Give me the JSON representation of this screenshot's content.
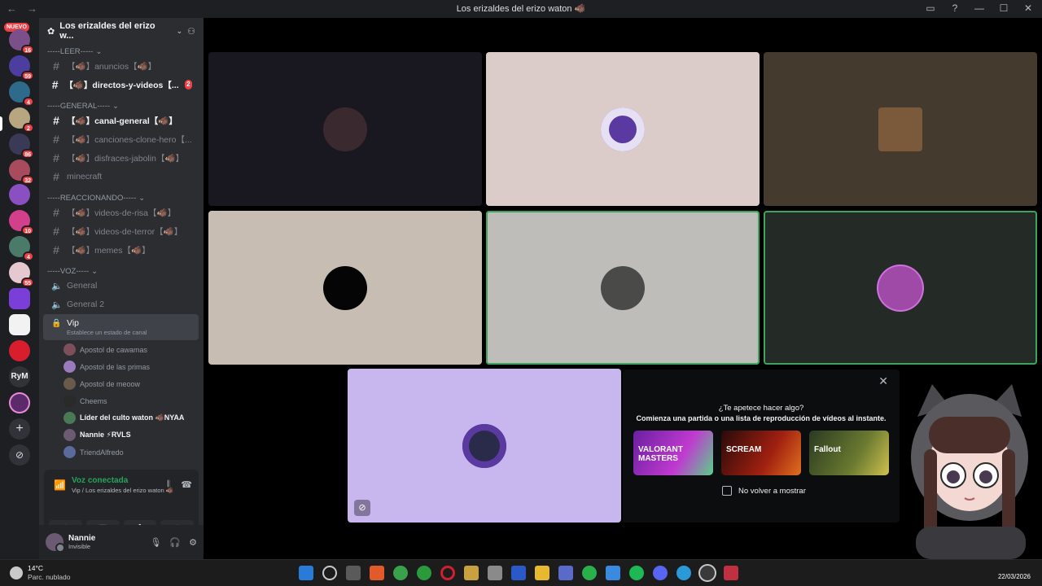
{
  "window": {
    "title": "Los erizaldes del erizo waton 🐗",
    "nav": [
      "←",
      "→"
    ],
    "controls": [
      "▭",
      "?",
      "—",
      "☐",
      "✕"
    ]
  },
  "rail": {
    "nuevo_label": "NUEVO",
    "badges": [
      "16",
      "59",
      "4",
      "2",
      "86",
      "32",
      "",
      "10",
      "4",
      "55"
    ],
    "text_server": "RyM"
  },
  "server": {
    "name": "Los erizaldes del erizo w...",
    "categories": {
      "leer": "-----LEER-----",
      "general": "-----GENERAL-----",
      "reaccionando": "-----REACCIONANDO-----",
      "voz": "-----VOZ-----"
    },
    "channels": {
      "anuncios": "【🐗】anuncios【🐗】",
      "directos": "【🐗】directos-y-videos【...",
      "directos_badge": "2",
      "canal_general": "【🐗】canal-general【🐗】",
      "canciones": "【🐗】canciones-clone-hero【...",
      "disfraces": "【🐗】disfraces-jabolin【🐗】",
      "minecraft": "minecraft",
      "risa": "【🐗】videos-de-risa【🐗】",
      "terror": "【🐗】videos-de-terror【🐗】",
      "memes": "【🐗】memes【🐗】",
      "voice_general": "General",
      "voice_general2": "General 2",
      "vip": "Vip",
      "vip_status": "Establece un estado de canal"
    },
    "members": [
      {
        "name": "Apostol de cawamas",
        "color": "#7d4e5c",
        "on": false
      },
      {
        "name": "Apostol de las primas",
        "color": "#9b7bbf",
        "on": false
      },
      {
        "name": "Apostol de meoow",
        "color": "#6a5a4a",
        "on": false
      },
      {
        "name": "Cheems",
        "color": "#2a2a2a",
        "on": false
      },
      {
        "name": "Líder del culto waton 🐗NYAA",
        "color": "#4a7a55",
        "on": true
      },
      {
        "name": "Nannie ⚡RVLS",
        "color": "#6b5a72",
        "on": true
      },
      {
        "name": "TriendAlfredo",
        "color": "#5a6a9a",
        "on": false
      }
    ]
  },
  "voice": {
    "status": "Voz conectada",
    "location": "Vip / Los erizaldes del erizo waton 🐗"
  },
  "user": {
    "name": "Nannie",
    "status": "Invisible"
  },
  "activity": {
    "question": "¿Te apetece hacer algo?",
    "description": "Comienza una partida o una lista de reproducción de vídeos al instante.",
    "games": [
      "VALORANT MASTERS",
      "SCREAM",
      "Fallout"
    ],
    "dont_show": "No volver a mostrar"
  },
  "taskbar": {
    "temperature": "14°C",
    "weather": "Parc. nublado",
    "date": "22/03/2026"
  },
  "colors": {
    "rail": "#1e1f22",
    "sidebar": "#2b2d31",
    "accent_green": "#23a55a",
    "badge_red": "#f23f43"
  }
}
